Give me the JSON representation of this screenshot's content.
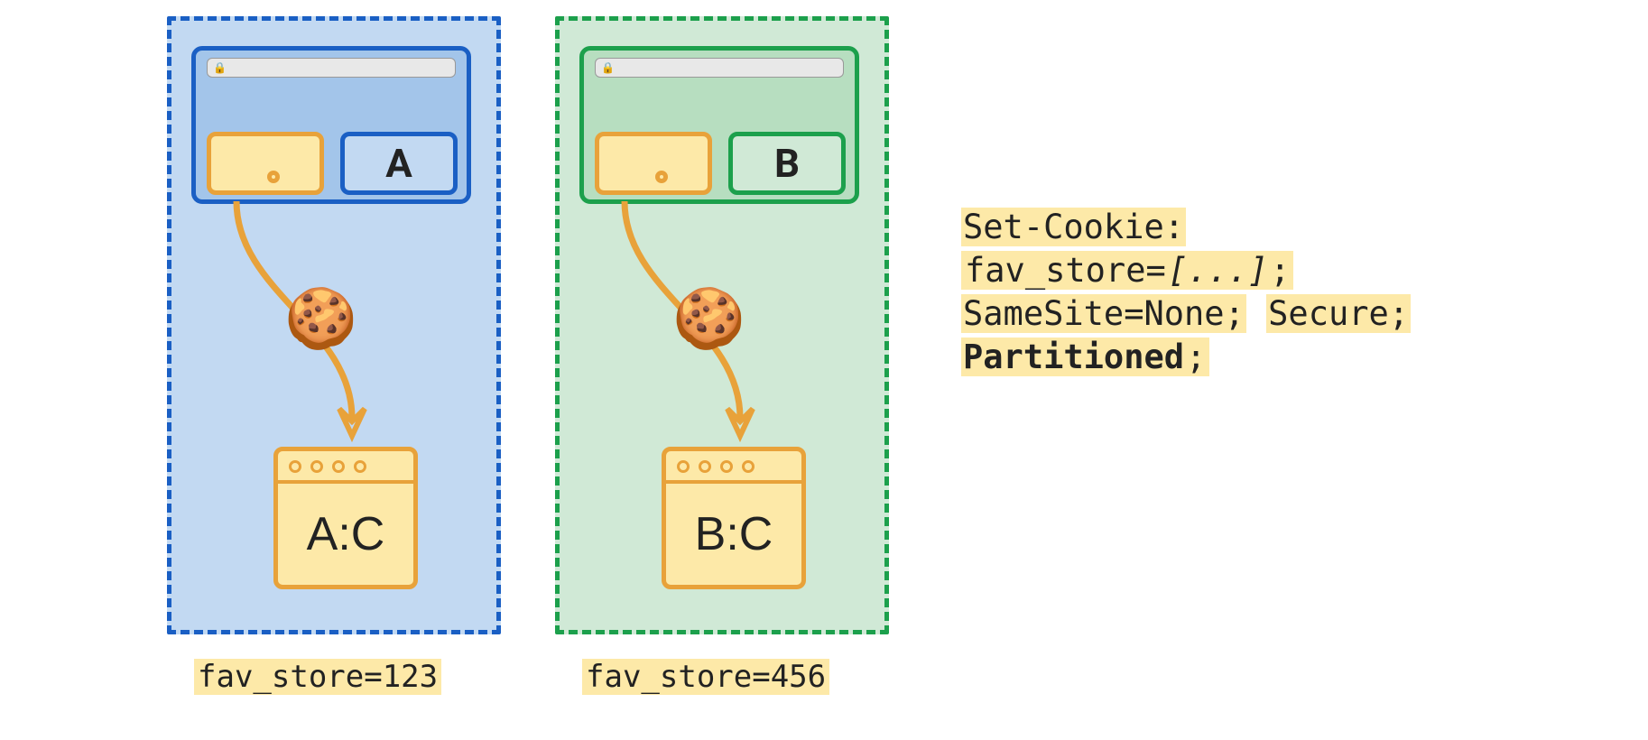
{
  "partitions": {
    "a": {
      "site_letter": "A",
      "jar_label": "A:C",
      "caption": "fav_store=123"
    },
    "b": {
      "site_letter": "B",
      "jar_label": "B:C",
      "caption": "fav_store=456"
    }
  },
  "code": {
    "line1": "Set-Cookie:",
    "line2a": "fav_store=",
    "line2b": "[...]",
    "line2c": ";",
    "line3a": "SameSite=None;",
    "line3b": "Secure;",
    "line4": "Partitioned",
    "line4b": ";"
  },
  "icons": {
    "cookie": "🍪",
    "lock": "🔒"
  }
}
